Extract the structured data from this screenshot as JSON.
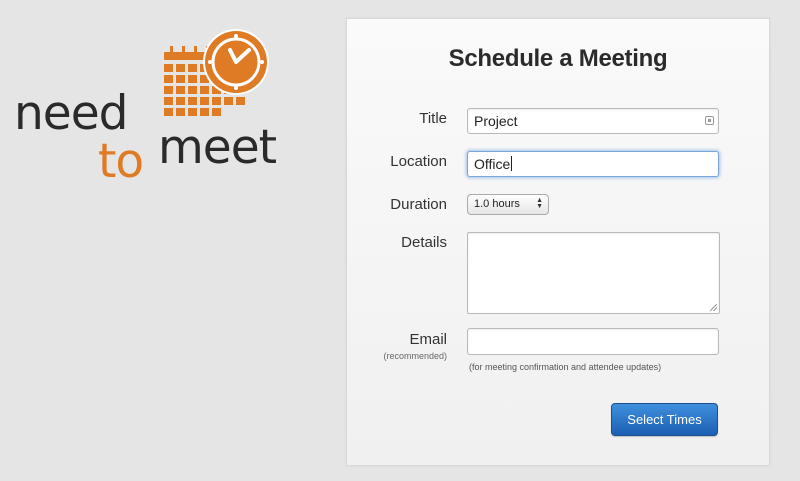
{
  "logo": {
    "word_need": "need",
    "word_to": "to",
    "word_meet": "meet",
    "colors": {
      "orange": "#e07b25",
      "dark": "#2a2a2a"
    }
  },
  "form": {
    "title": "Schedule a Meeting",
    "title_label": "Title",
    "title_value": "Project",
    "location_label": "Location",
    "location_value": "Office",
    "duration_label": "Duration",
    "duration_value": "1.0 hours",
    "details_label": "Details",
    "details_value": "",
    "email_label": "Email",
    "email_sublabel": "(recommended)",
    "email_value": "",
    "email_hint": "(for meeting confirmation and attendee updates)",
    "submit_label": "Select Times"
  },
  "colors": {
    "accent": "#1d5fb3",
    "focus_ring": "#7aa7d6",
    "background": "#e5e5e5"
  },
  "icons": {
    "title_field_icon": "input-helper-icon",
    "duration_arrows": "updown-arrows-icon"
  }
}
